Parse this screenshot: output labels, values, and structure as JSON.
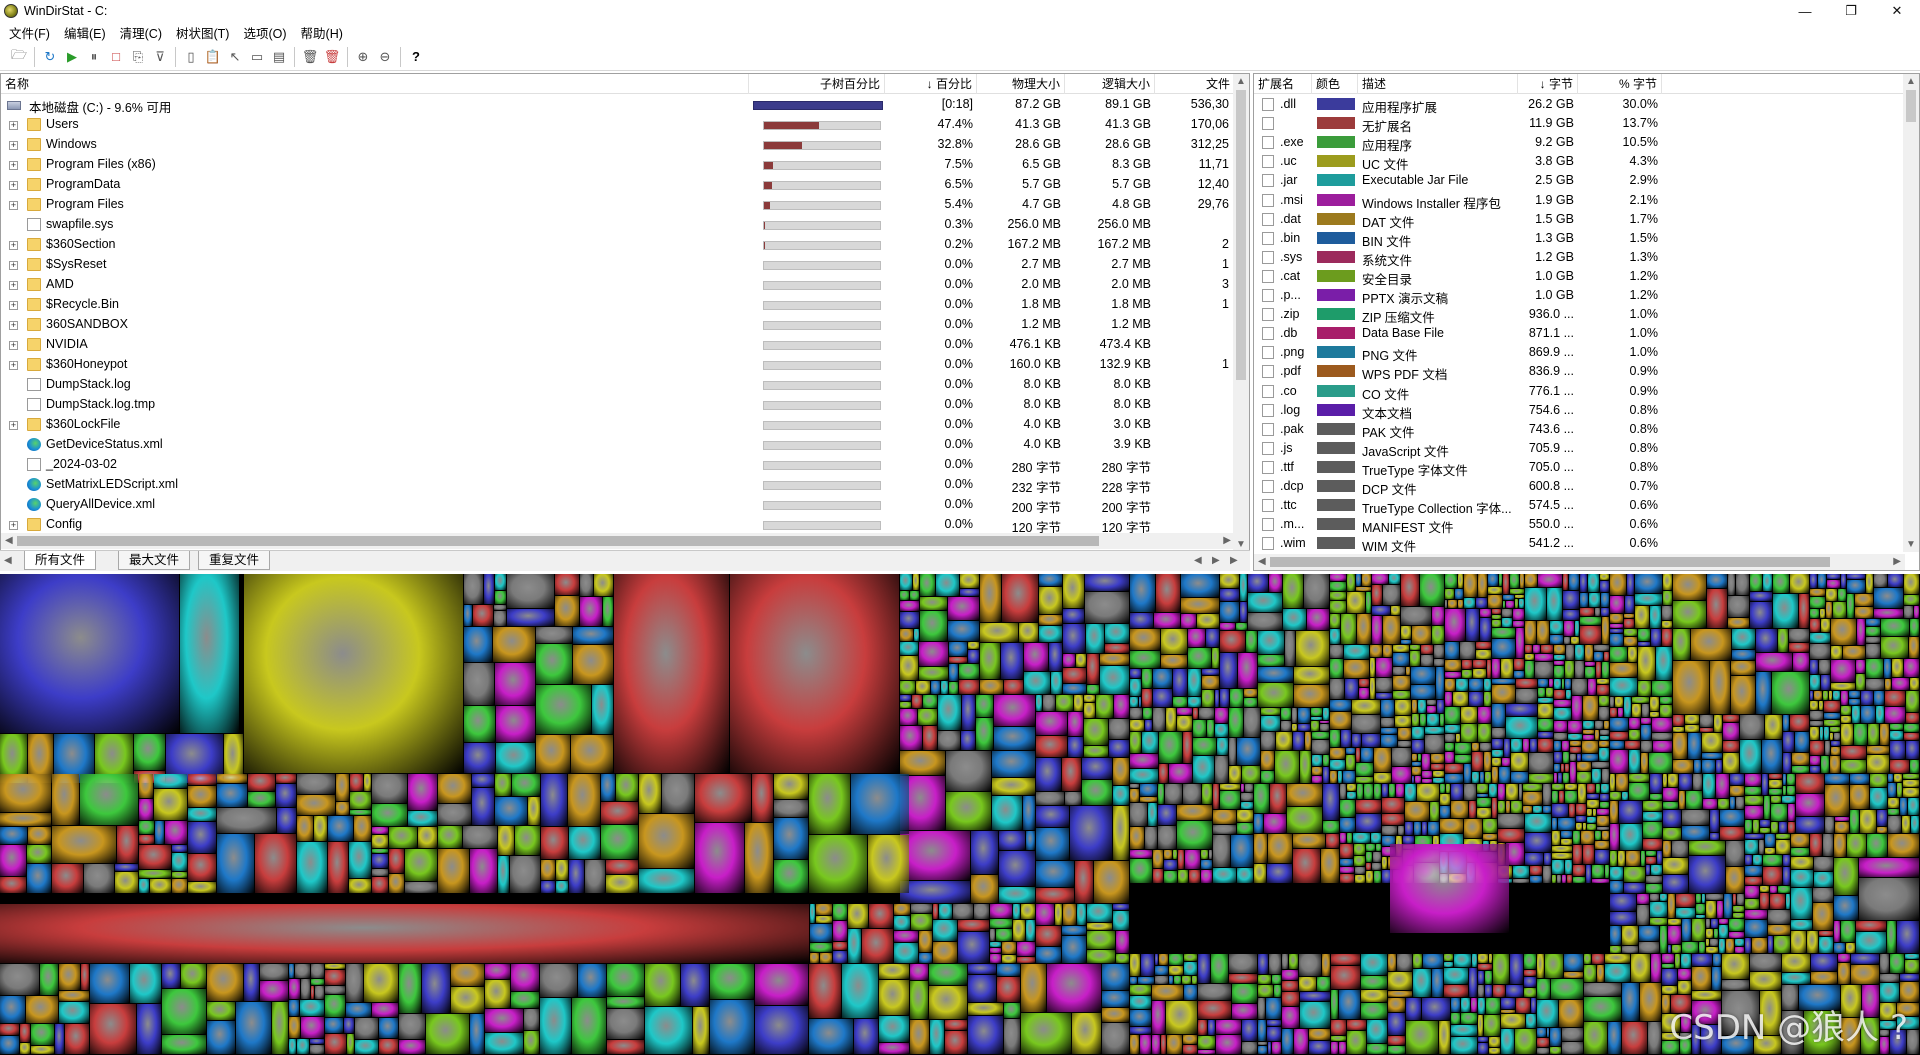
{
  "window": {
    "title": "WinDirStat - C:",
    "minimize": "—",
    "maximize": "❐",
    "close": "✕"
  },
  "menu": [
    "文件(F)",
    "编辑(E)",
    "清理(C)",
    "树状图(T)",
    "选项(O)",
    "帮助(H)"
  ],
  "toolbar": {
    "buttons": [
      {
        "name": "open-drive",
        "glyph": "🗁"
      },
      {
        "name": "refresh",
        "glyph": "↻"
      },
      {
        "name": "play",
        "glyph": "▶"
      },
      {
        "name": "pause",
        "glyph": "⏸"
      },
      {
        "name": "stop",
        "glyph": "□"
      },
      {
        "name": "copy",
        "glyph": "⎘"
      },
      {
        "name": "filter",
        "glyph": "⊽"
      },
      {
        "name": "new-doc",
        "glyph": "▯"
      },
      {
        "name": "paste",
        "glyph": "📋"
      },
      {
        "name": "select",
        "glyph": "↖"
      },
      {
        "name": "window",
        "glyph": "▭"
      },
      {
        "name": "properties",
        "glyph": "▤"
      },
      {
        "name": "delete",
        "glyph": "🗑"
      },
      {
        "name": "delete-permanent",
        "glyph": "🗑"
      },
      {
        "name": "zoom-in",
        "glyph": "⊕"
      },
      {
        "name": "zoom-out",
        "glyph": "⊖"
      },
      {
        "name": "help",
        "glyph": "?"
      }
    ]
  },
  "tree": {
    "headers": {
      "name": "名称",
      "subtree": "子树百分比",
      "pct": "↓ 百分比",
      "phys": "物理大小",
      "logical": "逻辑大小",
      "files": "文件"
    },
    "root": {
      "name": "本地磁盘 (C:) - 9.6% 可用",
      "pct": "[0:18]",
      "phys": "87.2 GB",
      "logical": "89.1 GB",
      "files": "536,30"
    },
    "rows": [
      {
        "name": "Users",
        "icon": "folder",
        "expand": true,
        "fill": 0.47,
        "pct": "47.4%",
        "phys": "41.3 GB",
        "logical": "41.3 GB",
        "files": "170,06"
      },
      {
        "name": "Windows",
        "icon": "folder",
        "expand": true,
        "fill": 0.33,
        "pct": "32.8%",
        "phys": "28.6 GB",
        "logical": "28.6 GB",
        "files": "312,25"
      },
      {
        "name": "Program Files (x86)",
        "icon": "folder",
        "expand": true,
        "fill": 0.075,
        "pct": "7.5%",
        "phys": "6.5 GB",
        "logical": "8.3 GB",
        "files": "11,71"
      },
      {
        "name": "ProgramData",
        "icon": "folder",
        "expand": true,
        "fill": 0.065,
        "pct": "6.5%",
        "phys": "5.7 GB",
        "logical": "5.7 GB",
        "files": "12,40"
      },
      {
        "name": "Program Files",
        "icon": "folder",
        "expand": true,
        "fill": 0.054,
        "pct": "5.4%",
        "phys": "4.7 GB",
        "logical": "4.8 GB",
        "files": "29,76"
      },
      {
        "name": "swapfile.sys",
        "icon": "file",
        "expand": false,
        "fill": 0.003,
        "pct": "0.3%",
        "phys": "256.0 MB",
        "logical": "256.0 MB",
        "files": ""
      },
      {
        "name": "$360Section",
        "icon": "folder",
        "expand": true,
        "fill": 0.002,
        "pct": "0.2%",
        "phys": "167.2 MB",
        "logical": "167.2 MB",
        "files": "2"
      },
      {
        "name": "$SysReset",
        "icon": "folder",
        "expand": true,
        "fill": 0,
        "pct": "0.0%",
        "phys": "2.7 MB",
        "logical": "2.7 MB",
        "files": "1"
      },
      {
        "name": "AMD",
        "icon": "folder",
        "expand": true,
        "fill": 0,
        "pct": "0.0%",
        "phys": "2.0 MB",
        "logical": "2.0 MB",
        "files": "3"
      },
      {
        "name": "$Recycle.Bin",
        "icon": "folder",
        "expand": true,
        "fill": 0,
        "pct": "0.0%",
        "phys": "1.8 MB",
        "logical": "1.8 MB",
        "files": "1"
      },
      {
        "name": "360SANDBOX",
        "icon": "folder",
        "expand": true,
        "fill": 0,
        "pct": "0.0%",
        "phys": "1.2 MB",
        "logical": "1.2 MB",
        "files": ""
      },
      {
        "name": "NVIDIA",
        "icon": "folder",
        "expand": true,
        "fill": 0,
        "pct": "0.0%",
        "phys": "476.1 KB",
        "logical": "473.4 KB",
        "files": ""
      },
      {
        "name": "$360Honeypot",
        "icon": "folder",
        "expand": true,
        "fill": 0,
        "pct": "0.0%",
        "phys": "160.0 KB",
        "logical": "132.9 KB",
        "files": "1"
      },
      {
        "name": "DumpStack.log",
        "icon": "file",
        "expand": false,
        "fill": 0,
        "pct": "0.0%",
        "phys": "8.0 KB",
        "logical": "8.0 KB",
        "files": ""
      },
      {
        "name": "DumpStack.log.tmp",
        "icon": "file",
        "expand": false,
        "fill": 0,
        "pct": "0.0%",
        "phys": "8.0 KB",
        "logical": "8.0 KB",
        "files": ""
      },
      {
        "name": "$360LockFile",
        "icon": "folder",
        "expand": true,
        "fill": 0,
        "pct": "0.0%",
        "phys": "4.0 KB",
        "logical": "3.0 KB",
        "files": ""
      },
      {
        "name": "GetDeviceStatus.xml",
        "icon": "edge",
        "expand": false,
        "fill": 0,
        "pct": "0.0%",
        "phys": "4.0 KB",
        "logical": "3.9 KB",
        "files": ""
      },
      {
        "name": "_2024-03-02",
        "icon": "file",
        "expand": false,
        "fill": 0,
        "pct": "0.0%",
        "phys": "280 字节",
        "logical": "280 字节",
        "files": ""
      },
      {
        "name": "SetMatrixLEDScript.xml",
        "icon": "edge",
        "expand": false,
        "fill": 0,
        "pct": "0.0%",
        "phys": "232 字节",
        "logical": "228 字节",
        "files": ""
      },
      {
        "name": "QueryAllDevice.xml",
        "icon": "edge",
        "expand": false,
        "fill": 0,
        "pct": "0.0%",
        "phys": "200 字节",
        "logical": "200 字节",
        "files": ""
      },
      {
        "name": "Config",
        "icon": "folder",
        "expand": true,
        "fill": 0,
        "pct": "0.0%",
        "phys": "120 字节",
        "logical": "120 字节",
        "files": ""
      }
    ]
  },
  "tabs": [
    "所有文件",
    "最大文件",
    "重复文件"
  ],
  "extensions": {
    "headers": {
      "ext": "扩展名",
      "color": "颜色",
      "desc": "描述",
      "bytes": "↓ 字节",
      "pct": "% 字节"
    },
    "rows": [
      {
        "ext": ".dll",
        "color": "#3b3b9c",
        "desc": "应用程序扩展",
        "bytes": "26.2 GB",
        "pct": "30.0%"
      },
      {
        "ext": "",
        "color": "#9c3b3b",
        "desc": "无扩展名",
        "bytes": "11.9 GB",
        "pct": "13.7%"
      },
      {
        "ext": ".exe",
        "color": "#3b9c3b",
        "desc": "应用程序",
        "bytes": "9.2 GB",
        "pct": "10.5%"
      },
      {
        "ext": ".uc",
        "color": "#9c9c1e",
        "desc": "UC 文件",
        "bytes": "3.8 GB",
        "pct": "4.3%"
      },
      {
        "ext": ".jar",
        "color": "#1e9c9c",
        "desc": "Executable Jar File",
        "bytes": "2.5 GB",
        "pct": "2.9%"
      },
      {
        "ext": ".msi",
        "color": "#9c1e9c",
        "desc": "Windows Installer 程序包",
        "bytes": "1.9 GB",
        "pct": "2.1%"
      },
      {
        "ext": ".dat",
        "color": "#9c7a1e",
        "desc": "DAT 文件",
        "bytes": "1.5 GB",
        "pct": "1.7%"
      },
      {
        "ext": ".bin",
        "color": "#1e5c9c",
        "desc": "BIN 文件",
        "bytes": "1.3 GB",
        "pct": "1.5%"
      },
      {
        "ext": ".sys",
        "color": "#9c2a5c",
        "desc": "系统文件",
        "bytes": "1.2 GB",
        "pct": "1.3%"
      },
      {
        "ext": ".cat",
        "color": "#6c9c1e",
        "desc": "安全目录",
        "bytes": "1.0 GB",
        "pct": "1.2%"
      },
      {
        "ext": ".p...",
        "color": "#7a1ea8",
        "desc": "PPTX 演示文稿",
        "bytes": "1.0 GB",
        "pct": "1.2%"
      },
      {
        "ext": ".zip",
        "color": "#1e9c6a",
        "desc": "ZIP 压缩文件",
        "bytes": "936.0 ...",
        "pct": "1.0%"
      },
      {
        "ext": ".db",
        "color": "#a81e6a",
        "desc": "Data Base File",
        "bytes": "871.1 ...",
        "pct": "1.0%"
      },
      {
        "ext": ".png",
        "color": "#1e7a9c",
        "desc": "PNG 文件",
        "bytes": "869.9 ...",
        "pct": "1.0%"
      },
      {
        "ext": ".pdf",
        "color": "#9c5a1e",
        "desc": "WPS PDF 文档",
        "bytes": "836.9 ...",
        "pct": "0.9%"
      },
      {
        "ext": ".co",
        "color": "#2a9c8a",
        "desc": "CO 文件",
        "bytes": "776.1 ...",
        "pct": "0.9%"
      },
      {
        "ext": ".log",
        "color": "#5a1ea8",
        "desc": "文本文档",
        "bytes": "754.6 ...",
        "pct": "0.8%"
      },
      {
        "ext": ".pak",
        "color": "#5c5c5c",
        "desc": "PAK 文件",
        "bytes": "743.6 ...",
        "pct": "0.8%"
      },
      {
        "ext": ".js",
        "color": "#5c5c5c",
        "desc": "JavaScript 文件",
        "bytes": "705.9 ...",
        "pct": "0.8%"
      },
      {
        "ext": ".ttf",
        "color": "#5c5c5c",
        "desc": "TrueType 字体文件",
        "bytes": "705.0 ...",
        "pct": "0.8%"
      },
      {
        "ext": ".dcp",
        "color": "#5c5c5c",
        "desc": "DCP 文件",
        "bytes": "600.8 ...",
        "pct": "0.7%"
      },
      {
        "ext": ".ttc",
        "color": "#5c5c5c",
        "desc": "TrueType Collection 字体...",
        "bytes": "574.5 ...",
        "pct": "0.6%"
      },
      {
        "ext": ".m...",
        "color": "#5c5c5c",
        "desc": "MANIFEST 文件",
        "bytes": "550.0 ...",
        "pct": "0.6%"
      },
      {
        "ext": ".wim",
        "color": "#5c5c5c",
        "desc": "WIM 文件",
        "bytes": "541.2 ...",
        "pct": "0.6%"
      }
    ]
  },
  "treemap": {
    "palette": [
      "#3d3dc8",
      "#c83d3d",
      "#3dc83d",
      "#c8c81e",
      "#1ec8c8",
      "#c81ec8",
      "#c8961e",
      "#7a7a7a",
      "#1e78c8",
      "#78c81e"
    ]
  },
  "watermark": "CSDN @狼人 ?"
}
